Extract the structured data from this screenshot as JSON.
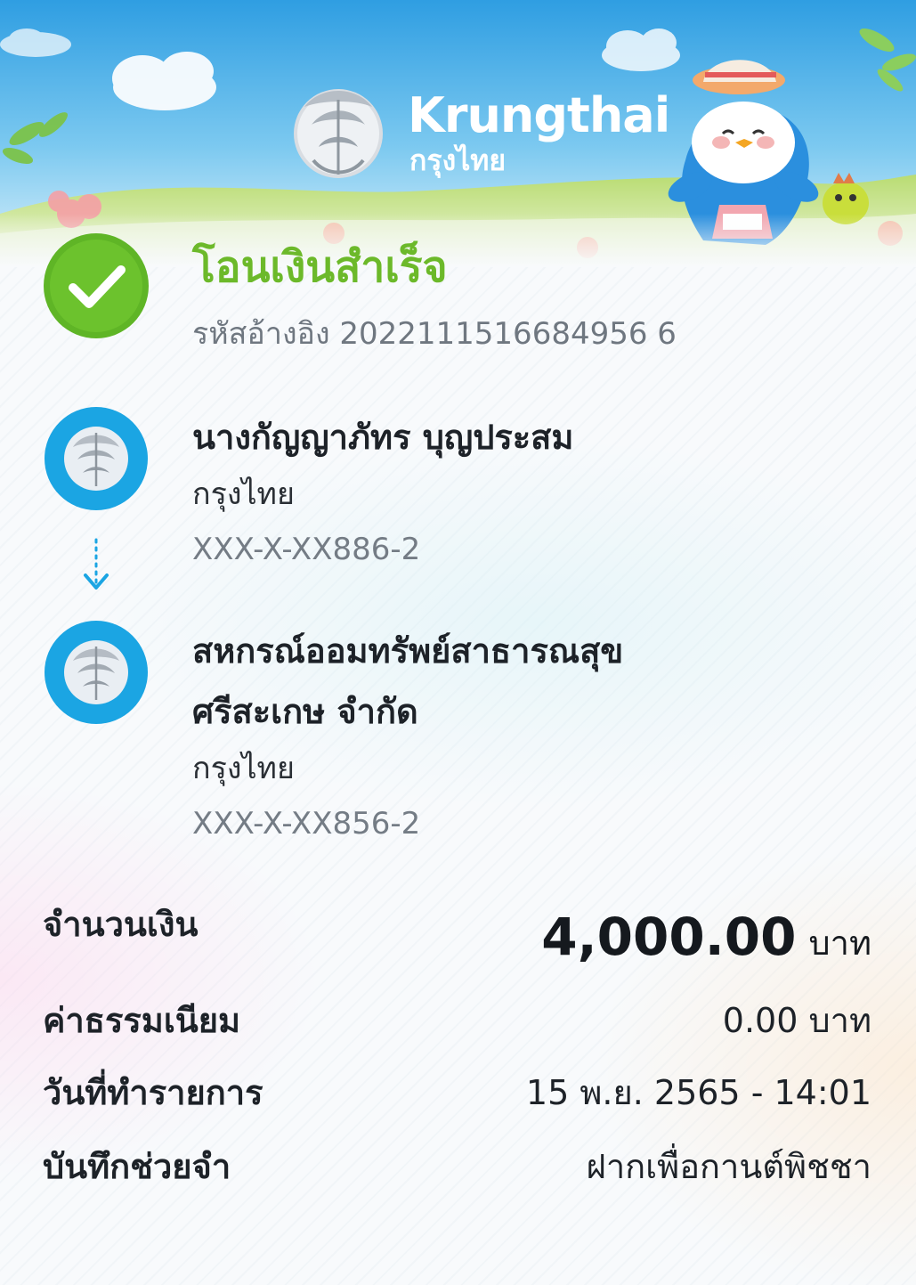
{
  "header": {
    "brand_en": "Krungthai",
    "brand_th": "กรุงไทย"
  },
  "status": {
    "title": "โอนเงินสำเร็จ",
    "reference_label": "รหัสอ้างอิง",
    "reference_number": "2022111516684956 6"
  },
  "sender": {
    "name": "นางกัญญาภัทร บุญประสม",
    "bank": "กรุงไทย",
    "account": "XXX-X-XX886-2"
  },
  "receiver": {
    "name_line1": "สหกรณ์ออมทรัพย์สาธารณสุข",
    "name_line2": "ศรีสะเกษ จำกัด",
    "bank": "กรุงไทย",
    "account": "XXX-X-XX856-2"
  },
  "details": {
    "amount_label": "จำนวนเงิน",
    "amount_value": "4,000.00",
    "amount_unit": "บาท",
    "fee_label": "ค่าธรรมเนียม",
    "fee_value": "0.00 บาท",
    "date_label": "วันที่ทำรายการ",
    "date_value": "15 พ.ย. 2565 - 14:01",
    "memo_label": "บันทึกช่วยจำ",
    "memo_value": "ฝากเพื่อกานต์พิชชา"
  },
  "colors": {
    "success_green": "#6cb92a",
    "bank_blue": "#1ba5e3",
    "sky_blue": "#3aa7e6"
  },
  "icons": {
    "logo": "krungthai-phoenix-logo",
    "status": "check-circle-icon",
    "flow": "arrow-down-icon",
    "mascot": "penguin-mascot"
  }
}
